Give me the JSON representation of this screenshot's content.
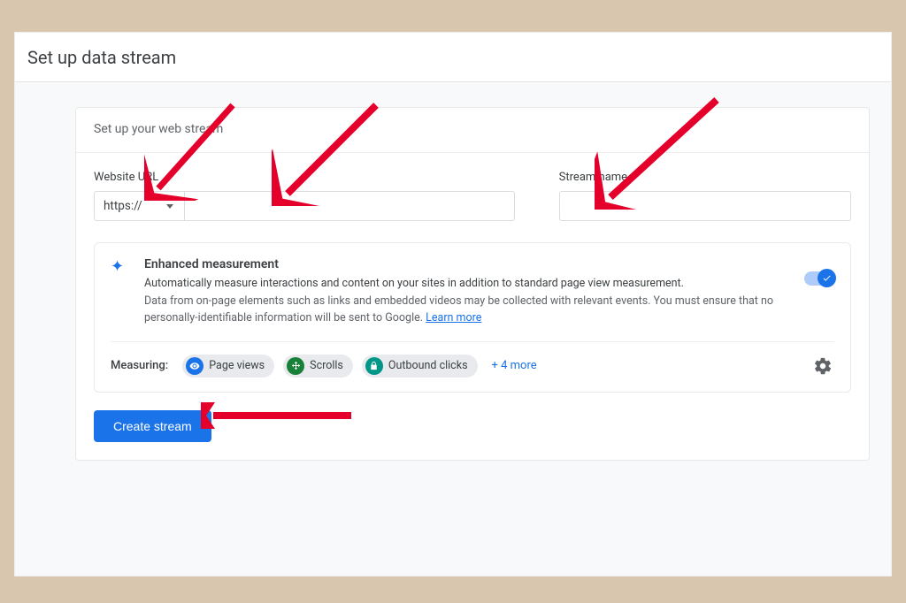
{
  "page_title": "Set up data stream",
  "panel_title": "Set up your web stream",
  "url_label": "Website URL",
  "url_protocol": "https://",
  "url_value": "",
  "name_label": "Stream name",
  "name_value": "",
  "enhanced": {
    "title": "Enhanced measurement",
    "subtitle": "Automatically measure interactions and content on your sites in addition to standard page view measurement.",
    "note": "Data from on-page elements such as links and embedded videos may be collected with relevant events. You must ensure that no personally-identifiable information will be sent to Google.",
    "learn_more": "Learn more"
  },
  "measuring_label": "Measuring:",
  "chips": {
    "page_views": "Page views",
    "scrolls": "Scrolls",
    "outbound": "Outbound clicks"
  },
  "more_text": "+ 4 more",
  "create_button": "Create stream"
}
